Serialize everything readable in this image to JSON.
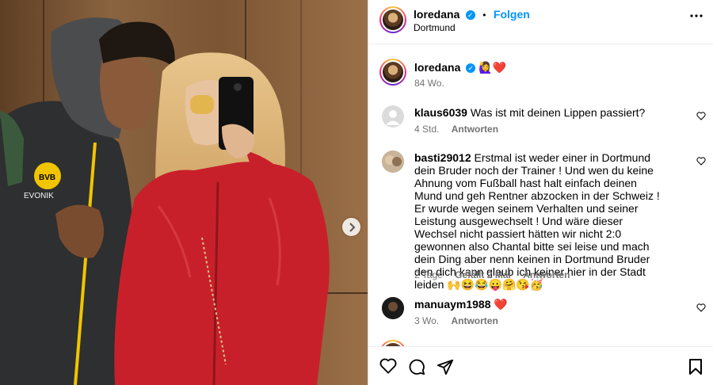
{
  "header": {
    "username": "loredana",
    "separator": "•",
    "follow_label": "Folgen",
    "location": "Dortmund"
  },
  "caption": {
    "username": "loredana",
    "text": "🙋‍♀️❤️",
    "age": "84 Wo."
  },
  "comments": [
    {
      "username": "klaus6039",
      "text": "Was ist mit deinen Lippen passiert?",
      "age": "4 Std.",
      "likes": "",
      "reply": "Antworten"
    },
    {
      "username": "basti29012",
      "text": "Erstmal ist weder einer in Dortmund dein Bruder noch der Trainer ! Und wen du keine Ahnung vom Fußball hast halt einfach deinen Mund und geh Rentner abzocken in der Schweiz ! Er wurde wegen seinem Verhalten und seiner Leistung ausgewechselt ! Und wäre dieser Wechsel nicht passiert hätten wir nicht 2:0 gewonnen also Chantal bitte sei leise und mach dein Ding aber nenn keinen in Dortmund Bruder den dich kann glaub ich keiner hier in der Stadt leiden 🙌😆😂😛🤗😘🥳",
      "age": "2 Tage",
      "likes": "Gefällt 2 Mal",
      "reply": "Antworten"
    },
    {
      "username": "manuaym1988",
      "text": "❤️",
      "age": "3 Wo.",
      "likes": "",
      "reply": "Antworten"
    }
  ],
  "icons": {
    "verified": "verified-badge-icon",
    "more": "more-options-icon",
    "next": "chevron-right-icon",
    "like": "heart-icon",
    "comment": "comment-icon",
    "share": "share-icon",
    "save": "bookmark-icon"
  },
  "colors": {
    "accent": "#0095f6",
    "muted": "#737373",
    "jacket": "#c8202a",
    "background_wall": "#7a5533"
  }
}
